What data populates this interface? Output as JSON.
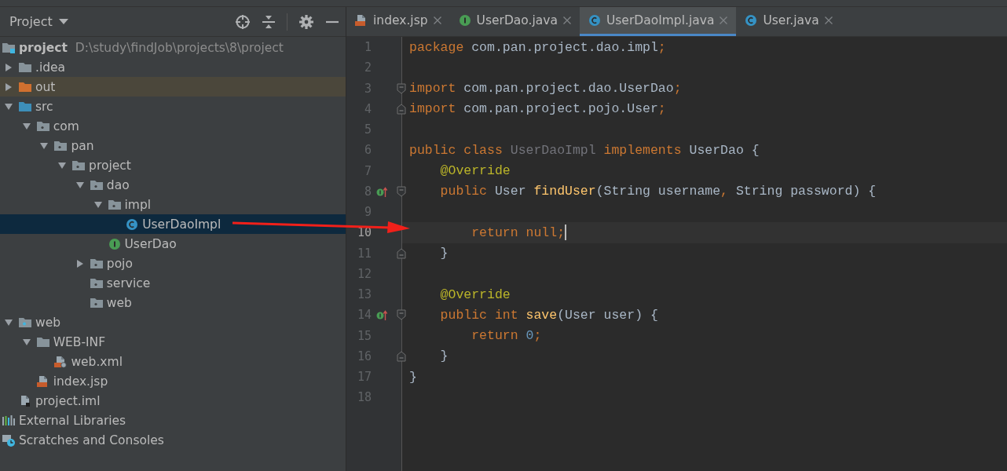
{
  "project_panel": {
    "title": "Project",
    "tree": [
      {
        "label": "project",
        "path": "D:\\study\\findJob\\projects\\8\\project",
        "kind": "module",
        "selected": false,
        "children": [
          {
            "label": ".idea",
            "kind": "folder",
            "expanded": false,
            "selected": false
          },
          {
            "label": "out",
            "kind": "excluded",
            "expanded": false,
            "selected": false,
            "highlighted": true
          },
          {
            "label": "src",
            "kind": "source",
            "expanded": true,
            "selected": false,
            "children": [
              {
                "label": "com",
                "kind": "package",
                "expanded": true,
                "selected": false,
                "children": [
                  {
                    "label": "pan",
                    "kind": "package",
                    "expanded": true,
                    "selected": false,
                    "children": [
                      {
                        "label": "project",
                        "kind": "package",
                        "expanded": true,
                        "selected": false,
                        "children": [
                          {
                            "label": "dao",
                            "kind": "package",
                            "expanded": true,
                            "selected": false,
                            "children": [
                              {
                                "label": "impl",
                                "kind": "package",
                                "expanded": true,
                                "selected": false,
                                "children": [
                                  {
                                    "label": "UserDaoImpl",
                                    "kind": "class",
                                    "selected": true
                                  }
                                ]
                              },
                              {
                                "label": "UserDao",
                                "kind": "interface",
                                "selected": false
                              }
                            ]
                          },
                          {
                            "label": "pojo",
                            "kind": "package",
                            "expanded": false,
                            "selected": false
                          },
                          {
                            "label": "service",
                            "kind": "package",
                            "selected": false
                          },
                          {
                            "label": "web",
                            "kind": "package",
                            "selected": false
                          }
                        ]
                      }
                    ]
                  }
                ]
              }
            ]
          },
          {
            "label": "web",
            "kind": "webroot",
            "expanded": true,
            "selected": false,
            "children": [
              {
                "label": "WEB-INF",
                "kind": "folder",
                "expanded": true,
                "selected": false,
                "children": [
                  {
                    "label": "web.xml",
                    "kind": "xml",
                    "selected": false
                  }
                ]
              },
              {
                "label": "index.jsp",
                "kind": "jsp",
                "selected": false
              }
            ]
          },
          {
            "label": "project.iml",
            "kind": "iml",
            "selected": false
          }
        ]
      },
      {
        "label": "External Libraries",
        "kind": "libraries",
        "selected": false
      },
      {
        "label": "Scratches and Consoles",
        "kind": "scratches",
        "selected": false
      }
    ]
  },
  "editor": {
    "tabs": [
      {
        "label": "index.jsp",
        "kind": "jsp",
        "selected": false
      },
      {
        "label": "UserDao.java",
        "kind": "interface",
        "selected": false
      },
      {
        "label": "UserDaoImpl.java",
        "kind": "class",
        "selected": true
      },
      {
        "label": "User.java",
        "kind": "class",
        "selected": false
      }
    ],
    "lines": [
      {
        "number": "1",
        "current": false,
        "fold_start": false,
        "fold_end": false,
        "overrides": false,
        "tokens": [
          {
            "kind": "kw",
            "text": "package "
          },
          {
            "kind": "plain",
            "text": "com.pan.project.dao.impl"
          },
          {
            "kind": "kw",
            "text": ";"
          }
        ]
      },
      {
        "number": "2",
        "current": false,
        "fold_start": false,
        "fold_end": false,
        "overrides": false
      },
      {
        "number": "3",
        "current": false,
        "fold_start": true,
        "fold_end": false,
        "overrides": false,
        "tokens": [
          {
            "kind": "kw",
            "text": "import "
          },
          {
            "kind": "plain",
            "text": "com.pan.project.dao.UserDao"
          },
          {
            "kind": "kw",
            "text": ";"
          }
        ]
      },
      {
        "number": "4",
        "current": false,
        "fold_start": false,
        "fold_end": true,
        "overrides": false,
        "tokens": [
          {
            "kind": "kw",
            "text": "import "
          },
          {
            "kind": "plain",
            "text": "com.pan.project.pojo.User"
          },
          {
            "kind": "kw",
            "text": ";"
          }
        ]
      },
      {
        "number": "5",
        "current": false,
        "fold_start": false,
        "fold_end": false,
        "overrides": false
      },
      {
        "number": "6",
        "current": false,
        "fold_start": false,
        "fold_end": false,
        "overrides": false,
        "tokens": [
          {
            "kind": "kw",
            "text": "public class "
          },
          {
            "kind": "unused",
            "text": "UserDaoImpl "
          },
          {
            "kind": "kw",
            "text": "implements "
          },
          {
            "kind": "plain",
            "text": "UserDao {"
          }
        ]
      },
      {
        "number": "7",
        "current": false,
        "fold_start": false,
        "fold_end": false,
        "overrides": false,
        "tokens": [
          {
            "kind": "ann",
            "text": "    @Override"
          }
        ]
      },
      {
        "number": "8",
        "current": false,
        "fold_start": true,
        "fold_end": false,
        "overrides": true,
        "tokens": [
          {
            "kind": "kw",
            "text": "    public "
          },
          {
            "kind": "plain",
            "text": "User "
          },
          {
            "kind": "fn",
            "text": "findUser"
          },
          {
            "kind": "plain",
            "text": "(String username"
          },
          {
            "kind": "kw",
            "text": ", "
          },
          {
            "kind": "plain",
            "text": "String password) {"
          }
        ]
      },
      {
        "number": "9",
        "current": false,
        "fold_start": false,
        "fold_end": false,
        "overrides": false
      },
      {
        "number": "10",
        "current": true,
        "fold_start": false,
        "fold_end": false,
        "overrides": false,
        "tokens": [
          {
            "kind": "kw",
            "text": "        return null;"
          }
        ]
      },
      {
        "number": "11",
        "current": false,
        "fold_start": false,
        "fold_end": true,
        "overrides": false,
        "tokens": [
          {
            "kind": "plain",
            "text": "    }"
          }
        ]
      },
      {
        "number": "12",
        "current": false,
        "fold_start": false,
        "fold_end": false,
        "overrides": false
      },
      {
        "number": "13",
        "current": false,
        "fold_start": false,
        "fold_end": false,
        "overrides": false,
        "tokens": [
          {
            "kind": "ann",
            "text": "    @Override"
          }
        ]
      },
      {
        "number": "14",
        "current": false,
        "fold_start": true,
        "fold_end": false,
        "overrides": true,
        "tokens": [
          {
            "kind": "kw",
            "text": "    public int "
          },
          {
            "kind": "fn",
            "text": "save"
          },
          {
            "kind": "plain",
            "text": "(User user) {"
          }
        ]
      },
      {
        "number": "15",
        "current": false,
        "fold_start": false,
        "fold_end": false,
        "overrides": false,
        "tokens": [
          {
            "kind": "kw",
            "text": "        return "
          },
          {
            "kind": "num",
            "text": "0"
          },
          {
            "kind": "kw",
            "text": ";"
          }
        ]
      },
      {
        "number": "16",
        "current": false,
        "fold_start": false,
        "fold_end": true,
        "overrides": false,
        "tokens": [
          {
            "kind": "plain",
            "text": "    }"
          }
        ]
      },
      {
        "number": "17",
        "current": false,
        "fold_start": false,
        "fold_end": false,
        "overrides": false,
        "tokens": [
          {
            "kind": "plain",
            "text": "}"
          }
        ]
      },
      {
        "number": "18",
        "current": false,
        "fold_start": false,
        "fold_end": false,
        "overrides": false
      }
    ]
  }
}
